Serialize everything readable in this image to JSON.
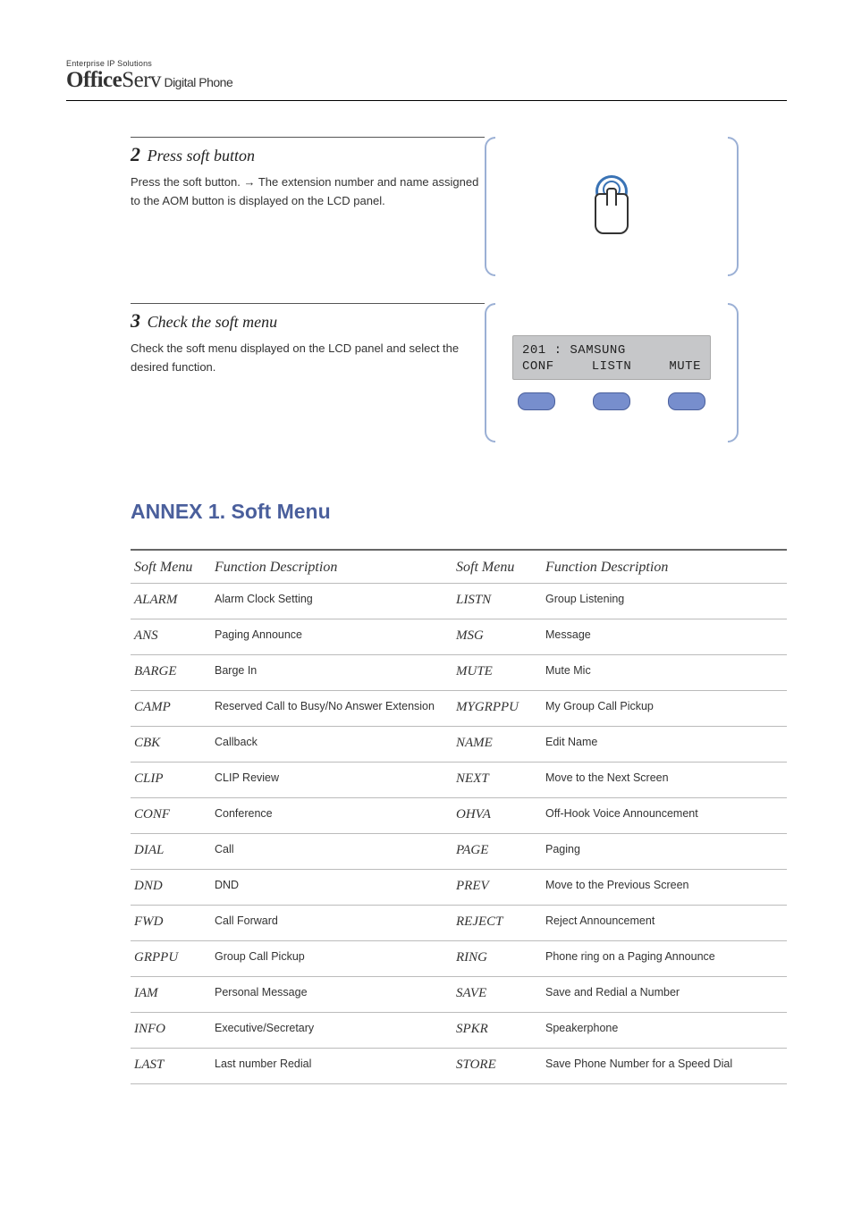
{
  "brand": {
    "top": "Enterprise IP Solutions",
    "bold": "Office",
    "serv": "Serv",
    "sub": " Digital Phone"
  },
  "steps": [
    {
      "num": "2",
      "label": "Press soft button",
      "body_prefix": "Press the soft button.",
      "body_arrow": " → ",
      "body_suffix": "The extension number and name assigned to the AOM button is displayed on the LCD panel.",
      "visual": "finger"
    },
    {
      "num": "3",
      "label": "Check the soft menu",
      "body": "Check the soft menu displayed on the LCD panel and select the desired function.",
      "visual": "lcd",
      "lcd": {
        "line1": "201 : SAMSUNG",
        "line2": [
          "CONF",
          "LISTN",
          "MUTE"
        ]
      }
    }
  ],
  "annex_title": "ANNEX 1. Soft Menu",
  "columns": [
    "Soft Menu",
    "Function Description",
    "Soft Menu",
    "Function Description"
  ],
  "rows": [
    [
      {
        "h": "ALARM"
      },
      "Alarm Clock Setting",
      {
        "h": "LISTN"
      },
      "Group Listening"
    ],
    [
      {
        "h": "ANS"
      },
      "Paging Announce",
      {
        "h": "MSG"
      },
      "Message"
    ],
    [
      {
        "h": "BARGE"
      },
      "Barge In",
      {
        "h": "MUTE"
      },
      "Mute Mic"
    ],
    [
      {
        "h": "CAMP"
      },
      "Reserved Call to Busy/No Answer Extension",
      {
        "h": "MYGRPPU"
      },
      "My Group Call Pickup"
    ],
    [
      {
        "h": "CBK"
      },
      "Callback",
      {
        "h": "NAME"
      },
      "Edit Name"
    ],
    [
      {
        "h": "CLIP"
      },
      "CLIP Review",
      {
        "h": "NEXT"
      },
      "Move to the Next Screen"
    ],
    [
      {
        "h": "CONF"
      },
      "Conference",
      {
        "h": "OHVA"
      },
      "Off-Hook Voice Announcement"
    ],
    [
      {
        "h": "DIAL"
      },
      "Call",
      {
        "h": "PAGE"
      },
      "Paging"
    ],
    [
      {
        "h": "DND"
      },
      "DND",
      {
        "h": "PREV"
      },
      "Move to the Previous Screen"
    ],
    [
      {
        "h": "FWD"
      },
      "Call Forward",
      {
        "h": "REJECT"
      },
      "Reject Announcement"
    ],
    [
      {
        "h": "GRPPU"
      },
      "Group Call Pickup",
      {
        "h": "RING"
      },
      "Phone ring on a Paging Announce"
    ],
    [
      {
        "h": "IAM"
      },
      "Personal Message",
      {
        "h": "SAVE"
      },
      "Save and Redial a Number"
    ],
    [
      {
        "h": "INFO"
      },
      "Executive/Secretary",
      {
        "h": "SPKR"
      },
      "Speakerphone"
    ],
    [
      {
        "h": "LAST"
      },
      "Last number Redial",
      {
        "h": "STORE"
      },
      "Save Phone Number for a Speed Dial"
    ]
  ]
}
